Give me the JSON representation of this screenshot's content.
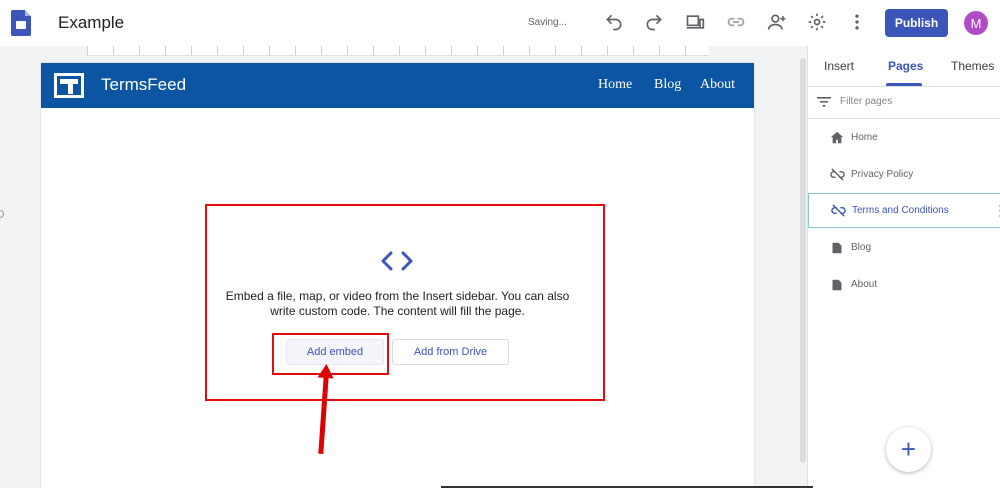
{
  "app": {
    "title": "Example",
    "status": "Saving...",
    "publish_label": "Publish",
    "avatar_initial": "M",
    "accent_color": "#3c55b9"
  },
  "toolbar": {
    "icons": [
      "undo-icon",
      "redo-icon",
      "preview-icon",
      "link-icon",
      "add-person-icon",
      "gear-icon",
      "more-vert-icon"
    ]
  },
  "site": {
    "name": "TermsFeed",
    "nav": [
      "Home",
      "Blog",
      "About"
    ],
    "header_color": "#0b55a3"
  },
  "embed": {
    "description": "Embed a file, map, or video from the Insert sidebar. You can also write custom code. The content will fill the page.",
    "add_embed_label": "Add embed",
    "add_from_drive_label": "Add from Drive"
  },
  "panel": {
    "tabs": [
      {
        "label": "Insert",
        "active": false
      },
      {
        "label": "Pages",
        "active": true
      },
      {
        "label": "Themes",
        "active": false
      }
    ],
    "filter_placeholder": "Filter pages",
    "pages": [
      {
        "label": "Home",
        "icon": "home-icon"
      },
      {
        "label": "Privacy Policy",
        "icon": "hidden-link-icon"
      },
      {
        "label": "Terms and Conditions",
        "icon": "hidden-link-icon",
        "selected": true
      },
      {
        "label": "Blog",
        "icon": "page-icon"
      },
      {
        "label": "About",
        "icon": "page-icon"
      }
    ],
    "fab_label": "+"
  }
}
